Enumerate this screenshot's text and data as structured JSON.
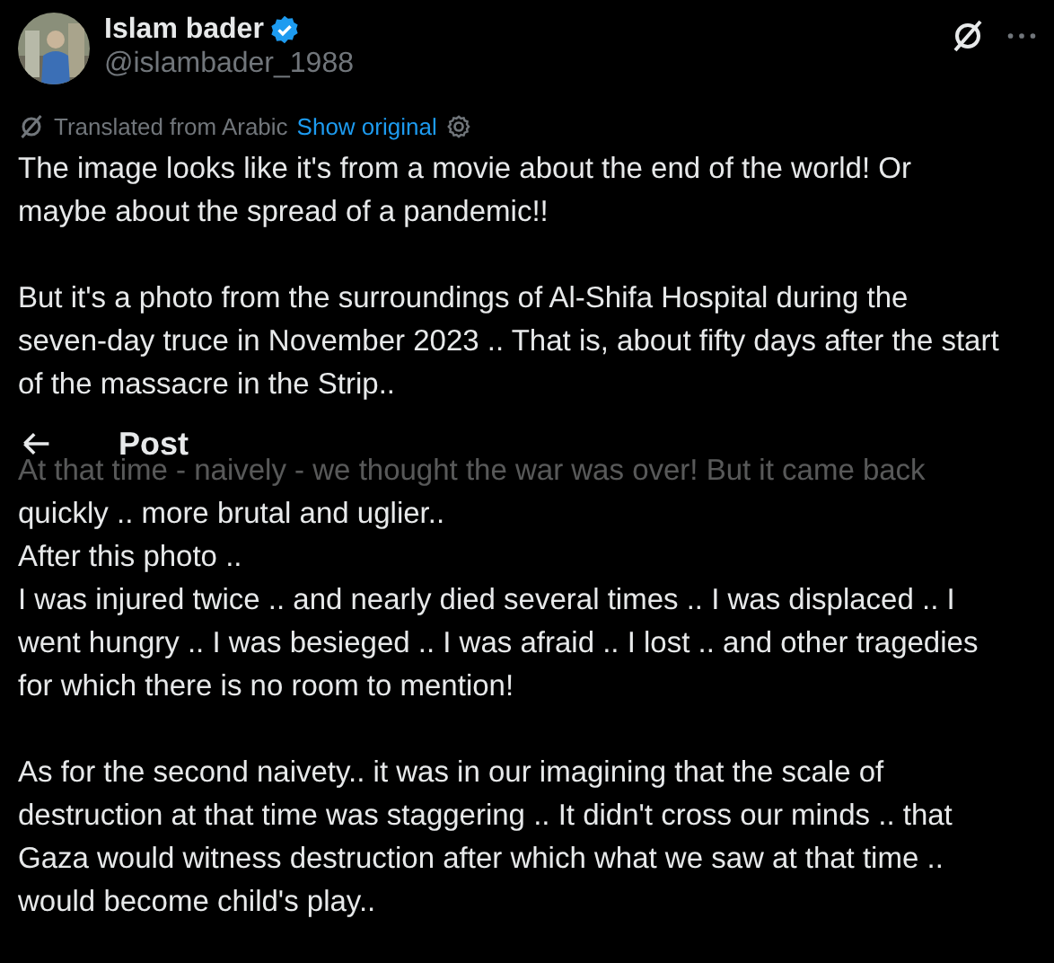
{
  "post": {
    "author": {
      "name": "Islam bader",
      "verified": true,
      "handle": "@islambader_1988"
    },
    "translation": {
      "label": "Translated from Arabic",
      "link": "Show original"
    },
    "paragraphs": [
      "The image looks like it's from a movie about the end of the world! Or maybe about the spread of a pandemic!!",
      "But it's a photo from the surroundings of Al-Shifa Hospital during the seven-day truce in November 2023 .. That is, about fifty days after the start of the massacre in the Strip..",
      "At that time - naively - we thought the war was over! But it came back quickly .. more brutal and uglier..\nAfter this photo ..\nI was injured twice .. and nearly died several times .. I was displaced .. I went hungry .. I was besieged .. I was afraid .. I lost .. and other tragedies for which there is no room to mention!",
      "As for the second naivety.. it was in our imagining that the scale of destruction at that time was staggering .. It didn't cross our minds .. that Gaza would witness destruction after which what we saw at that time .. would become child's play.."
    ]
  },
  "header": {
    "title": "Post"
  }
}
